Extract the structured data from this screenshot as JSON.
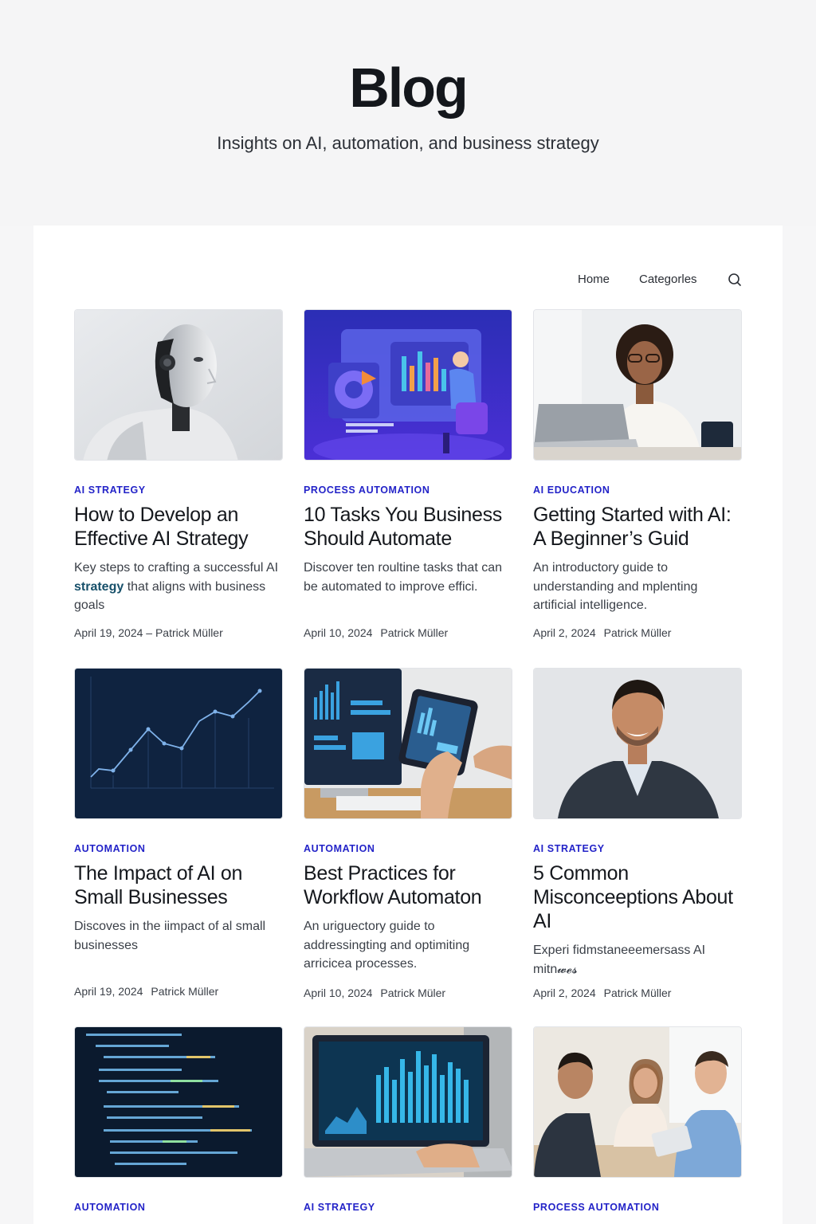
{
  "hero": {
    "title": "Blog",
    "subtitle": "Insights on AI, automation, and business strategy"
  },
  "nav": {
    "home": "Home",
    "categories": "Categorles",
    "search_icon": "search-icon"
  },
  "colors": {
    "category": "#2323c8",
    "highlight": "#17506a",
    "background": "#f6f6f7"
  },
  "posts": [
    {
      "category": "AI STRATEGY",
      "title": "How to Develop an Effective AI Strategy",
      "excerpt_pre": "Key steps to crafting a successful AI ",
      "excerpt_highlight": "strategy",
      "excerpt_post": " that aligns with business goals",
      "date": "April 19, 2024 – Patrick Müller",
      "author": "",
      "image": "humanoid-robot"
    },
    {
      "category": "PROCESS AUTOMATION",
      "title": "10 Tasks You Business Should Automate",
      "excerpt": "Discover ten roultine tasks that can be automated to improve effici.",
      "date": "April 10, 2024",
      "author": "Patrick Müller",
      "image": "dashboard-illustration"
    },
    {
      "category": "AI EDUCATION",
      "title": "Getting Started with AI: A Beginner’s Guid",
      "excerpt": "An introductory guide to understanding and mplenting artificial intelligence.",
      "date": "April 2, 2024",
      "author": "Patrick Müller",
      "image": "woman-at-laptop"
    },
    {
      "category": "AUTOMATION",
      "title": "The Impact of AI on Small Businesses",
      "excerpt": "Discoves in the iimpact of al small businesses",
      "date": "April 19, 2024",
      "author": "Patrick Müller",
      "image": "line-chart"
    },
    {
      "category": "AUTOMATION",
      "title": "Best Practices for Workflow Automaton",
      "excerpt": "An uriguectory guide to addressingting and optimiting arricicea processes.",
      "date": "April 10, 2024",
      "author": "Patrick Müler",
      "image": "tablet-analytics"
    },
    {
      "category": "AI STRATEGY",
      "title": "5 Common Misconceeptions About AI",
      "excerpt": "Experi fidmstaneeemersass AI mitn𝔀𝓮𝓼",
      "date": "April 2, 2024",
      "author": "Patrick Müller",
      "image": "smiling-man"
    },
    {
      "category": "AUTOMATION",
      "image": "code-screen"
    },
    {
      "category": "AI STRATEGY",
      "image": "laptop-bar-chart"
    },
    {
      "category": "PROCESS AUTOMATION",
      "image": "team-meeting"
    }
  ]
}
